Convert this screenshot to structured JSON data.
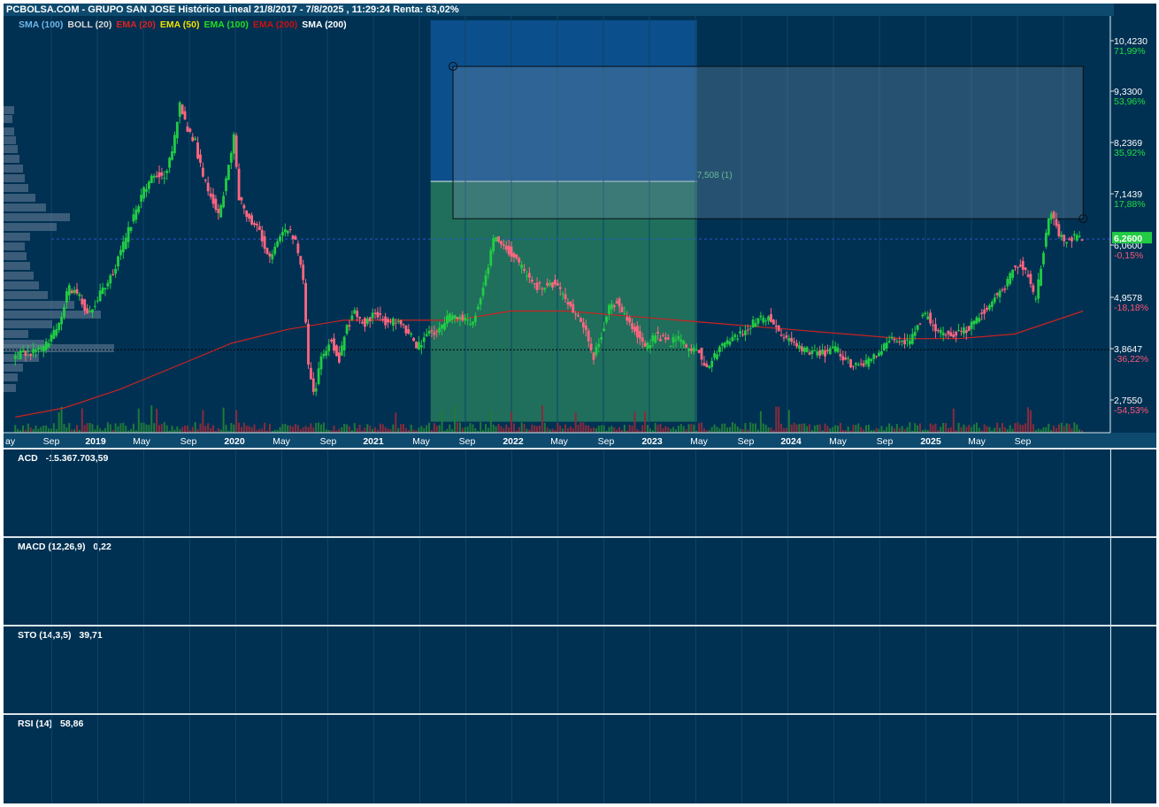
{
  "title": "PCBOLSA.COM - GRUPO SAN JOSE Histórico Lineal 21/8/2017 - 7/8/2025 , 11:29:24 Renta: 63,02%",
  "legend": [
    {
      "text": "SMA (100)",
      "color": "#6fb4e8"
    },
    {
      "text": "BOLL (20)",
      "color": "#d8d8d8"
    },
    {
      "text": "EMA (20)",
      "color": "#e02020"
    },
    {
      "text": "EMA (50)",
      "color": "#f0e000"
    },
    {
      "text": "EMA (100)",
      "color": "#22dd22"
    },
    {
      "text": "EMA (200)",
      "color": "#cc1010"
    },
    {
      "text": "SMA (200)",
      "color": "#ffffff"
    }
  ],
  "colors": {
    "background": "#003152",
    "up": "#22cc44",
    "down": "#ff6680",
    "ema200": "#cc2222",
    "last_price": "#22cc44"
  },
  "chart_data": {
    "type": "candlestick",
    "price_levels": [
      {
        "price": "10,4230",
        "pct": "71,99%",
        "pct_color": "#22dd44"
      },
      {
        "price": "9,3300",
        "pct": "53,96%",
        "pct_color": "#22dd44"
      },
      {
        "price": "8,2369",
        "pct": "35,92%",
        "pct_color": "#22dd44"
      },
      {
        "price": "7,1439",
        "pct": "17,88%",
        "pct_color": "#22dd44"
      },
      {
        "price": "6,0600",
        "pct": "-0,15%",
        "pct_color": "#ff5577"
      },
      {
        "price": "4,9578",
        "pct": "-18,18%",
        "pct_color": "#ff5577"
      },
      {
        "price": "3,8647",
        "pct": "-36,22%",
        "pct_color": "#ff5577"
      },
      {
        "price": "2,7550",
        "pct": "-54,53%",
        "pct_color": "#ff5577"
      }
    ],
    "last_price": "6,2600",
    "x_ticks": [
      "ay",
      "Sep",
      "2019",
      "May",
      "Sep",
      "2020",
      "May",
      "Sep",
      "2021",
      "May",
      "Sep",
      "2022",
      "May",
      "Sep",
      "2023",
      "May",
      "Sep",
      "2024",
      "May",
      "Sep",
      "2025",
      "May",
      "Sep"
    ],
    "price_path": [
      [
        "2017-08-21",
        3.7
      ],
      [
        "2017-11-15",
        3.9
      ],
      [
        "2017-12-25",
        4.4
      ],
      [
        "2018-01-20",
        5.2
      ],
      [
        "2018-02-20",
        5.0
      ],
      [
        "2018-03-10",
        4.6
      ],
      [
        "2018-04-10",
        5.0
      ],
      [
        "2018-05-25",
        5.6
      ],
      [
        "2018-07-05",
        6.5
      ],
      [
        "2018-08-10",
        7.3
      ],
      [
        "2018-09-10",
        7.7
      ],
      [
        "2018-10-05",
        7.6
      ],
      [
        "2018-10-25",
        8.0
      ],
      [
        "2018-11-20",
        9.2
      ],
      [
        "2018-12-05",
        8.7
      ],
      [
        "2018-12-30",
        8.4
      ],
      [
        "2019-01-20",
        7.6
      ],
      [
        "2019-02-10",
        7.2
      ],
      [
        "2019-03-05",
        6.8
      ],
      [
        "2019-03-25",
        7.5
      ],
      [
        "2019-04-15",
        8.5
      ],
      [
        "2019-04-28",
        7.2
      ],
      [
        "2019-05-20",
        6.8
      ],
      [
        "2019-06-20",
        6.5
      ],
      [
        "2019-07-20",
        5.8
      ],
      [
        "2019-08-20",
        6.4
      ],
      [
        "2019-09-10",
        6.5
      ],
      [
        "2019-10-01",
        6.2
      ],
      [
        "2019-10-20",
        5.5
      ],
      [
        "2019-11-05",
        3.4
      ],
      [
        "2019-11-20",
        2.9
      ],
      [
        "2019-12-10",
        3.7
      ],
      [
        "2020-01-05",
        4.1
      ],
      [
        "2020-01-25",
        3.6
      ],
      [
        "2020-02-15",
        4.3
      ],
      [
        "2020-03-10",
        4.7
      ],
      [
        "2020-04-05",
        4.4
      ],
      [
        "2020-05-05",
        4.7
      ],
      [
        "2020-06-05",
        4.4
      ],
      [
        "2020-07-05",
        4.5
      ],
      [
        "2020-08-05",
        4.2
      ],
      [
        "2020-08-25",
        3.9
      ],
      [
        "2020-09-25",
        4.2
      ],
      [
        "2020-10-25",
        4.3
      ],
      [
        "2020-11-25",
        4.6
      ],
      [
        "2020-12-25",
        4.6
      ],
      [
        "2021-01-20",
        4.4
      ],
      [
        "2021-02-15",
        5.0
      ],
      [
        "2021-03-05",
        5.6
      ],
      [
        "2021-03-25",
        6.4
      ],
      [
        "2021-04-10",
        6.2
      ],
      [
        "2021-05-05",
        6.0
      ],
      [
        "2021-06-01",
        5.7
      ],
      [
        "2021-07-01",
        5.3
      ],
      [
        "2021-08-01",
        5.2
      ],
      [
        "2021-09-01",
        5.3
      ],
      [
        "2021-10-01",
        5.0
      ],
      [
        "2021-11-01",
        4.6
      ],
      [
        "2021-12-01",
        4.2
      ],
      [
        "2021-12-20",
        3.7
      ],
      [
        "2022-01-10",
        4.2
      ],
      [
        "2022-02-01",
        4.8
      ],
      [
        "2022-02-20",
        4.9
      ],
      [
        "2022-03-15",
        4.6
      ],
      [
        "2022-04-10",
        4.3
      ],
      [
        "2022-05-10",
        3.9
      ],
      [
        "2022-06-10",
        4.2
      ],
      [
        "2022-07-10",
        4.0
      ],
      [
        "2022-08-10",
        4.1
      ],
      [
        "2022-09-10",
        3.8
      ],
      [
        "2022-10-01",
        3.9
      ],
      [
        "2022-10-20",
        3.4
      ],
      [
        "2022-11-10",
        3.7
      ],
      [
        "2022-12-10",
        4.0
      ],
      [
        "2023-01-10",
        4.1
      ],
      [
        "2023-02-10",
        4.3
      ],
      [
        "2023-03-10",
        4.5
      ],
      [
        "2023-04-10",
        4.6
      ],
      [
        "2023-05-10",
        4.2
      ],
      [
        "2023-06-10",
        4.0
      ],
      [
        "2023-07-10",
        3.9
      ],
      [
        "2023-08-10",
        3.8
      ],
      [
        "2023-09-10",
        3.8
      ],
      [
        "2023-10-10",
        3.9
      ],
      [
        "2023-11-10",
        3.6
      ],
      [
        "2023-12-10",
        3.5
      ],
      [
        "2024-01-10",
        3.6
      ],
      [
        "2024-02-05",
        3.8
      ],
      [
        "2024-02-25",
        4.0
      ],
      [
        "2024-03-25",
        4.1
      ],
      [
        "2024-04-25",
        4.0
      ],
      [
        "2024-05-25",
        4.5
      ],
      [
        "2024-06-15",
        4.6
      ],
      [
        "2024-07-15",
        4.2
      ],
      [
        "2024-08-15",
        4.2
      ],
      [
        "2024-09-15",
        4.2
      ],
      [
        "2024-10-15",
        4.4
      ],
      [
        "2024-11-15",
        4.7
      ],
      [
        "2024-12-15",
        5.0
      ],
      [
        "2025-01-15",
        5.2
      ],
      [
        "2025-02-05",
        5.7
      ],
      [
        "2025-02-25",
        5.7
      ],
      [
        "2025-03-15",
        5.5
      ],
      [
        "2025-04-05",
        4.9
      ],
      [
        "2025-04-20",
        5.6
      ],
      [
        "2025-05-05",
        6.4
      ],
      [
        "2025-05-20",
        6.9
      ],
      [
        "2025-06-05",
        6.4
      ],
      [
        "2025-06-25",
        6.2
      ],
      [
        "2025-07-15",
        6.3
      ],
      [
        "2025-08-07",
        6.26
      ]
    ],
    "ema200_path": [
      [
        "2017-08-21",
        2.4
      ],
      [
        "2018-01-01",
        2.6
      ],
      [
        "2018-06-01",
        3.0
      ],
      [
        "2018-11-01",
        3.5
      ],
      [
        "2019-04-01",
        4.0
      ],
      [
        "2019-09-01",
        4.3
      ],
      [
        "2020-02-01",
        4.5
      ],
      [
        "2020-07-01",
        4.5
      ],
      [
        "2020-12-01",
        4.5
      ],
      [
        "2021-05-01",
        4.7
      ],
      [
        "2021-10-01",
        4.7
      ],
      [
        "2022-03-01",
        4.6
      ],
      [
        "2022-08-01",
        4.5
      ],
      [
        "2023-01-01",
        4.4
      ],
      [
        "2023-06-01",
        4.3
      ],
      [
        "2023-11-01",
        4.2
      ],
      [
        "2024-04-01",
        4.1
      ],
      [
        "2024-09-01",
        4.1
      ],
      [
        "2025-02-01",
        4.2
      ],
      [
        "2025-08-07",
        4.7
      ]
    ],
    "drawing_box": {
      "from_date": "2020-11-25",
      "to_date": "2025-08-07",
      "from_price": 10.0,
      "to_price": 6.7
    },
    "zones": [
      {
        "from_date": "2020-09-25",
        "to_date": "2022-09-20",
        "from_price": 11.0,
        "to_price": 7.508,
        "color": "#0b4f8c"
      },
      {
        "from_date": "2020-09-25",
        "to_date": "2022-09-20",
        "from_price": 7.508,
        "to_price": 2.3,
        "color": "#1f6f5c"
      }
    ],
    "zone_label": "7,508 (1)",
    "dotted_level": 3.86,
    "dashed_level": 6.26
  },
  "panes": [
    {
      "name": "ACD",
      "value": "-15.367.703,59"
    },
    {
      "name": "MACD (12,26,9)",
      "value": "0,22"
    },
    {
      "name": "STO (14,3,5)",
      "value": "39,71"
    },
    {
      "name": "RSI (14)",
      "value": "58,86"
    }
  ]
}
